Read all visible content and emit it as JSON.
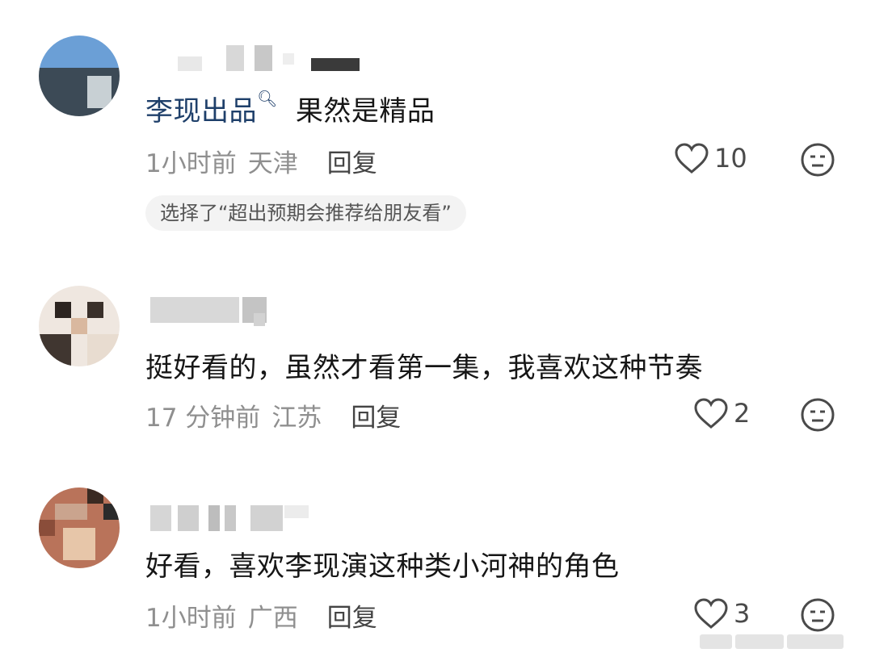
{
  "comments": [
    {
      "author_link": "李现出品",
      "author_icon": "search-icon",
      "text": "果然是精品",
      "time": "1小时前",
      "location": "天津",
      "reply_label": "回复",
      "likes": "10",
      "tag": "选择了“超出预期会推荐给朋友看”"
    },
    {
      "text": "挺好看的，虽然才看第一集，我喜欢这种节奏",
      "time": "17 分钟前",
      "location": "江苏",
      "reply_label": "回复",
      "likes": "2"
    },
    {
      "text": "好看，喜欢李现演这种类小河神的角色",
      "time": "1小时前",
      "location": "广西",
      "reply_label": "回复",
      "likes": "3"
    }
  ],
  "icons": {
    "like": "heart-outline-icon",
    "dislike": "neutral-face-icon"
  },
  "colors": {
    "text": "#161616",
    "meta": "#8f8f8f",
    "author_link": "#1e3f6a",
    "tag_bg": "#f3f3f3"
  }
}
